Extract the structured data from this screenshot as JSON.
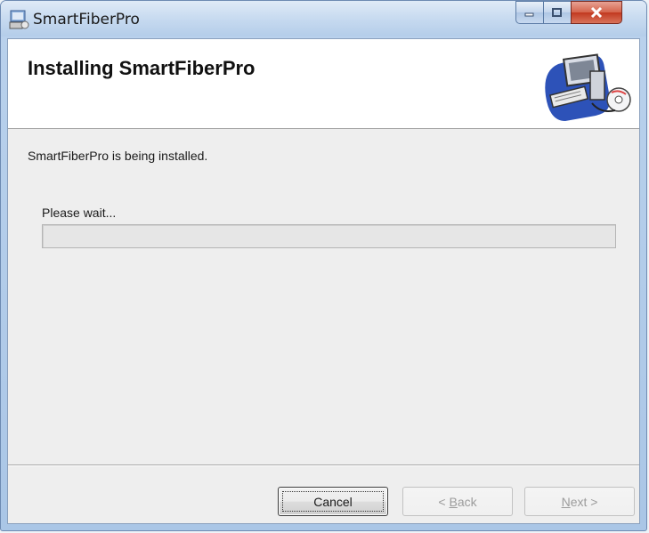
{
  "window": {
    "title": "SmartFiberPro",
    "app_icon": "installer-icon",
    "controls": {
      "minimize": "minimize-icon",
      "maximize": "maximize-icon",
      "close": "close-icon"
    }
  },
  "banner": {
    "title": "Installing SmartFiberPro",
    "art": "computer-disk-icon"
  },
  "body": {
    "status": "SmartFiberPro is being installed.",
    "wait_label": "Please wait...",
    "progress_fraction": 0
  },
  "buttons": {
    "cancel": "Cancel",
    "back_prefix": "< ",
    "back_mnemonic": "B",
    "back_rest": "ack",
    "next_mnemonic": "N",
    "next_rest": "ext >"
  },
  "colors": {
    "title_bar": "#c5d9ef",
    "close_button": "#c2391f",
    "dialog_background": "#eeeeee",
    "banner_background": "#ffffff"
  }
}
